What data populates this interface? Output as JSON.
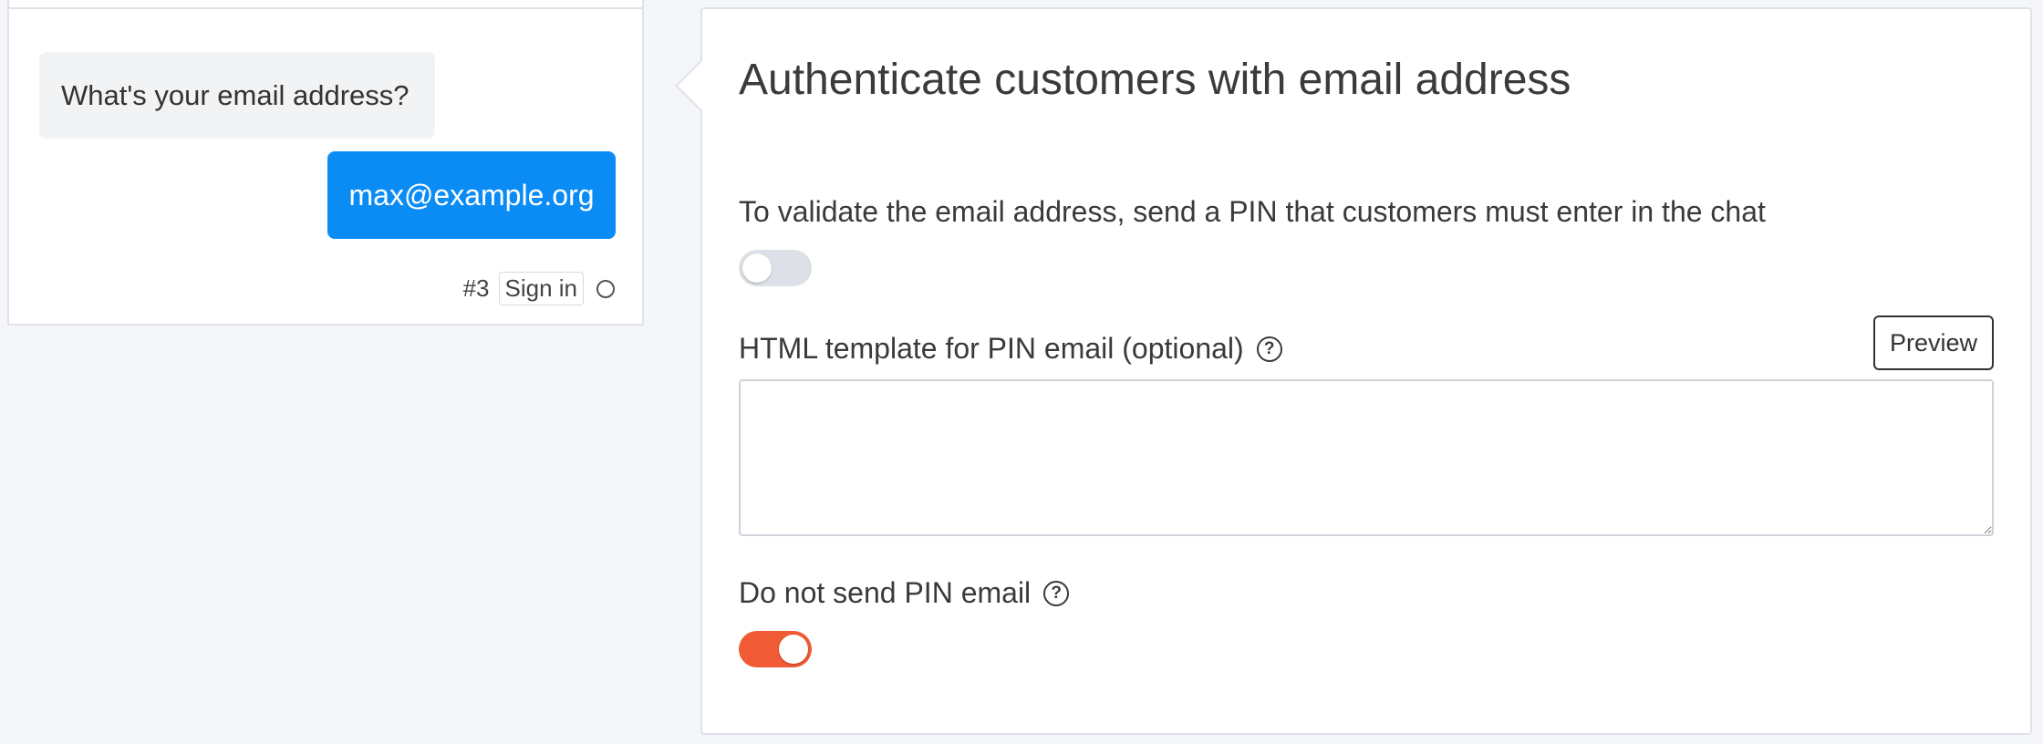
{
  "chat_preview": {
    "bot_message": "What's your email address?",
    "user_message": "max@example.org",
    "step_number": "#3",
    "step_label": "Sign in"
  },
  "settings": {
    "title": "Authenticate customers with email address",
    "validate_label": "To validate the email address, send a PIN that customers must enter in the chat",
    "validate_toggle": {
      "on": false,
      "color": "#dde0e6"
    },
    "template_label": "HTML template for PIN email (optional)",
    "template_help_icon": "question-circle-icon",
    "preview_button": "Preview",
    "template_value": "",
    "no_pin_label": "Do not send PIN email",
    "no_pin_help_icon": "question-circle-icon",
    "no_pin_toggle": {
      "on": true,
      "color": "#f05a35"
    }
  },
  "colors": {
    "accent_blue": "#0b8cf5",
    "toggle_on": "#f05a35",
    "toggle_off": "#dde0e6",
    "background": "#f5f6fa"
  }
}
